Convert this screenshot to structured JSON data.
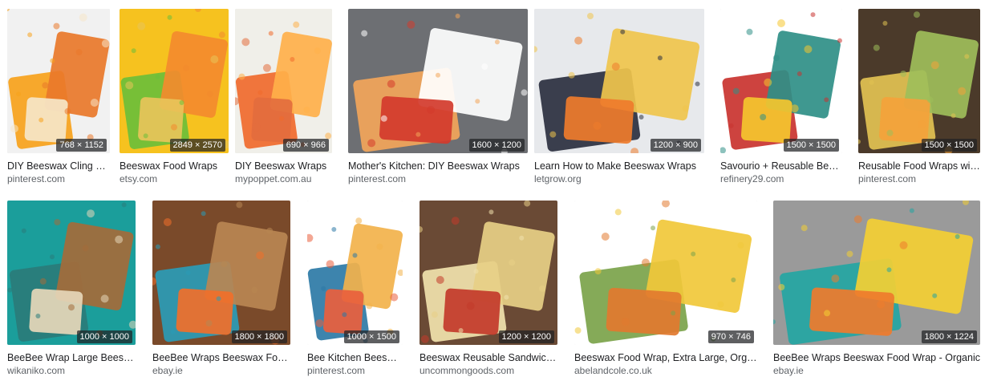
{
  "results": [
    {
      "title": "DIY Beeswax Cling Wrap",
      "source": "pinterest.com",
      "dims": "768 × 1152"
    },
    {
      "title": "Beeswax Food Wraps",
      "source": "etsy.com",
      "dims": "2849 × 2570"
    },
    {
      "title": "DIY Beeswax Wraps",
      "source": "mypoppet.com.au",
      "dims": "690 × 966"
    },
    {
      "title": "Mother's Kitchen: DIY Beeswax Wraps",
      "source": "pinterest.com",
      "dims": "1600 × 1200"
    },
    {
      "title": "Learn How to Make Beeswax Wraps",
      "source": "letgrow.org",
      "dims": "1200 × 900"
    },
    {
      "title": "Savourio + Reusable Beeswax Wraps",
      "source": "refinery29.com",
      "dims": "1500 × 1500"
    },
    {
      "title": "Reusable Food Wraps with Beeswax",
      "source": "pinterest.com",
      "dims": "1500 × 1500"
    },
    {
      "title": "BeeBee Wrap Large Beeswax Wraps",
      "source": "wikaniko.com",
      "dims": "1000 × 1000"
    },
    {
      "title": "BeeBee Wraps Beeswax Food Wraps",
      "source": "ebay.ie",
      "dims": "1800 × 1800"
    },
    {
      "title": "Bee Kitchen Beeswax Wraps",
      "source": "pinterest.com",
      "dims": "1000 × 1500"
    },
    {
      "title": "Beeswax Reusable Sandwich Wrap",
      "source": "uncommongoods.com",
      "dims": "1200 × 1200"
    },
    {
      "title": "Beeswax Food Wrap, Extra Large, Organic",
      "source": "abelandcole.co.uk",
      "dims": "970 × 746"
    },
    {
      "title": "BeeBee Wraps Beeswax Food Wrap - Organic",
      "source": "ebay.ie",
      "dims": "1800 × 1224"
    }
  ],
  "thumb_colors": [
    [
      "#f1f1f1",
      "#f7a21b",
      "#e9782a",
      "#f5e6c8"
    ],
    [
      "#f6c21f",
      "#6bbf3a",
      "#f38b2e",
      "#e8c45a"
    ],
    [
      "#f0efe9",
      "#f06a2c",
      "#ffb04a",
      "#e36d3e"
    ],
    [
      "#6d6f73",
      "#f3a55a",
      "#ffffff",
      "#d33a2c"
    ],
    [
      "#e7e9ec",
      "#2b2f3f",
      "#f0c44c",
      "#ef7b2b"
    ],
    [
      "#ffffff",
      "#c9332f",
      "#2f8f87",
      "#f5c62e"
    ],
    [
      "#4b3a2a",
      "#e2c252",
      "#9ebe5a",
      "#f4a23b"
    ],
    [
      "#1b9e9b",
      "#2a7c7a",
      "#a46b3a",
      "#e6d7b9"
    ],
    [
      "#7a4a2a",
      "#2a9bb6",
      "#b88652",
      "#f06f2a"
    ],
    [
      "#ffffff",
      "#2c79a6",
      "#f2b24b",
      "#e95f3d"
    ],
    [
      "#6a4a35",
      "#f1e2ad",
      "#e7cf86",
      "#c33a2a"
    ],
    [
      "#ffffff",
      "#7ba34a",
      "#f1c83a",
      "#e27a2f"
    ],
    [
      "#9a9a9a",
      "#24a6a3",
      "#f4cf33",
      "#ef7b2c"
    ]
  ]
}
